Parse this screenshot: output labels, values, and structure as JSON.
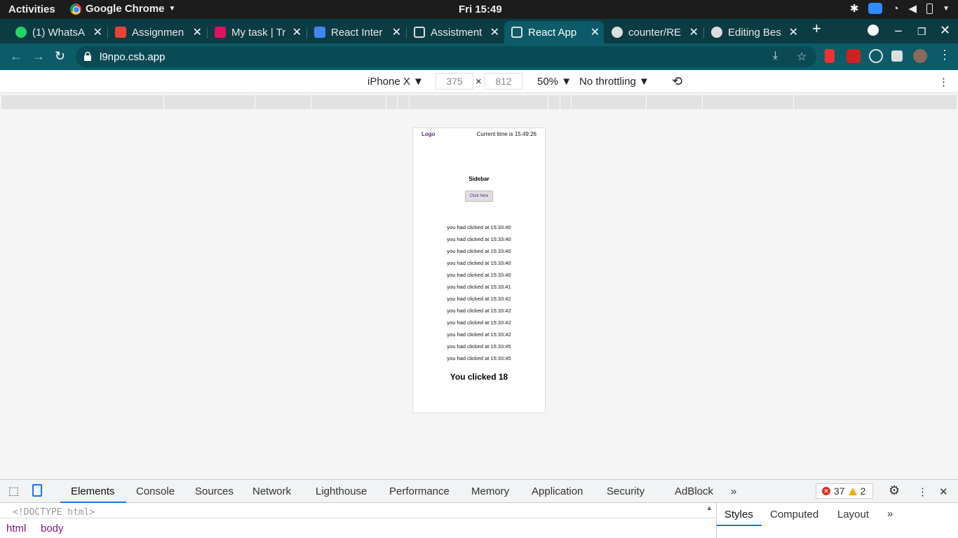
{
  "system_bar": {
    "activities": "Activities",
    "app_name": "Google Chrome",
    "clock": "Fri 15:49"
  },
  "tabs": [
    {
      "label": "(1) WhatsA",
      "icon": "whatsapp-icon",
      "color": "#25d366"
    },
    {
      "label": "Assignmen",
      "icon": "gmail-icon",
      "color": "#ea4335"
    },
    {
      "label": "My task | Tr",
      "icon": "task-icon",
      "color": "#e0115f"
    },
    {
      "label": "React Inter",
      "icon": "docs-icon",
      "color": "#4285f4"
    },
    {
      "label": "Assistment",
      "icon": "codesandbox-icon",
      "color": "#dddddd"
    },
    {
      "label": "React App",
      "icon": "codesandbox-icon",
      "color": "#dddddd"
    },
    {
      "label": "counter/RE",
      "icon": "github-icon",
      "color": "#dddddd"
    },
    {
      "label": "Editing Bes",
      "icon": "github-icon",
      "color": "#dddddd"
    }
  ],
  "address_bar": {
    "url": "l9npo.csb.app"
  },
  "device_toolbar": {
    "device": "iPhone X",
    "width": "375",
    "height": "812",
    "zoom": "50%",
    "throttling": "No throttling"
  },
  "app": {
    "logo": "Logo",
    "current_time": "Current time is 15:49:26",
    "sidebar_title": "Sidebar",
    "button_label": "Click here",
    "click_log": [
      "you had clicked at 15:33:40",
      "you had clicked at 15:33:40",
      "you had clicked at 15:33:40",
      "you had clicked at 15:33:40",
      "you had clicked at 15:33:40",
      "you had clicked at 15:33:41",
      "you had clicked at 15:33:42",
      "you had clicked at 15:33:42",
      "you had clicked at 15:33:42",
      "you had clicked at 15:33:42",
      "you had clicked at 15:33:45",
      "you had clicked at 15:33:45"
    ],
    "counter_text": "You clicked 18"
  },
  "devtools": {
    "tabs": [
      "Elements",
      "Console",
      "Sources",
      "Network",
      "Lighthouse",
      "Performance",
      "Memory",
      "Application",
      "Security",
      "AdBlock"
    ],
    "errors": "37",
    "warnings": "2",
    "doctype": "<!DOCTYPE html>",
    "breadcrumbs": [
      "html",
      "body"
    ],
    "side_tabs": [
      "Styles",
      "Computed",
      "Layout"
    ]
  }
}
